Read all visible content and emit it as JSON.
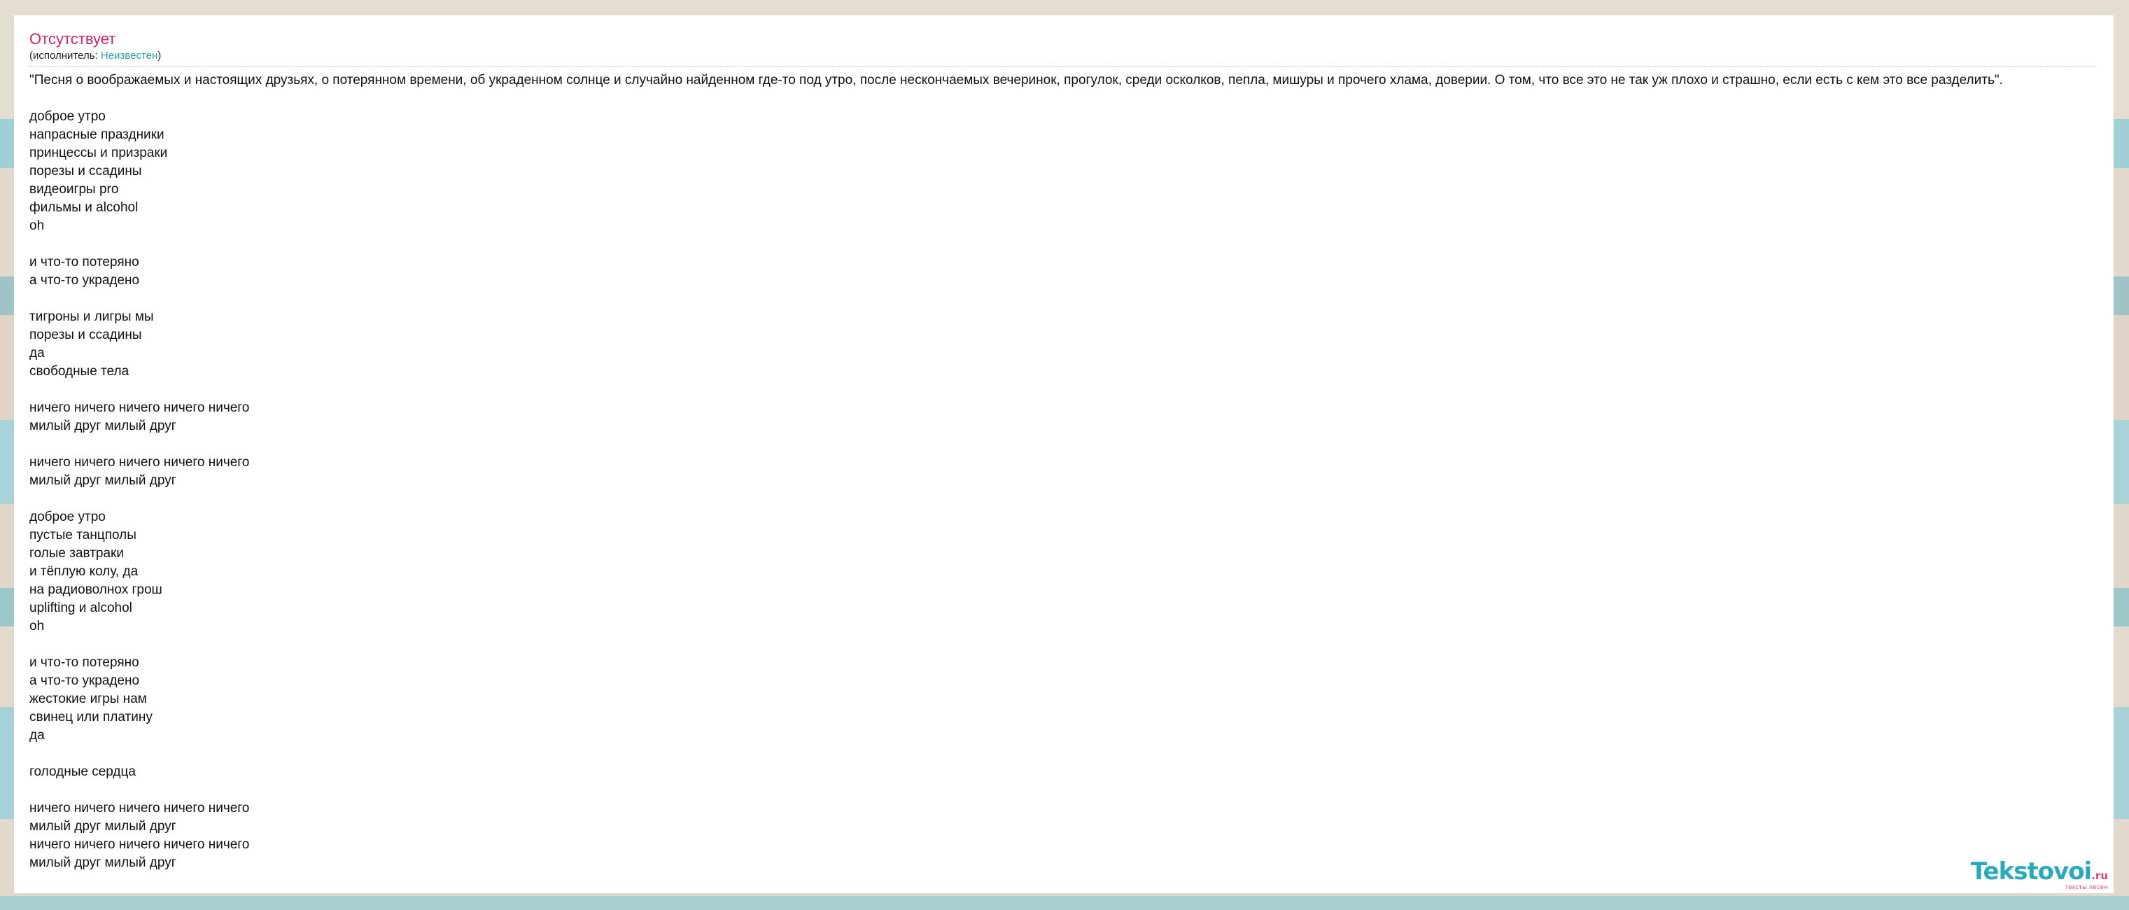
{
  "song": {
    "title": "Отсутствует",
    "artist_prefix": "(исполнитель: ",
    "artist_name": "Неизвестен",
    "artist_suffix": ")"
  },
  "description": "\"Песня о воображаемых и настоящих друзьях, о потерянном времени, об украденном солнце и случайно найденном где-то под утро, после нескончаемых вечеринок, прогулок, среди осколков, пепла, мишуры и прочего хлама, доверии. О том, что все это не так уж плохо и страшно, если есть с кем это все разделить\".",
  "lyrics": [
    "доброе утро",
    "напрасные праздники",
    "принцессы и призраки",
    "порезы и ссадины",
    "видеоигры pro",
    "фильмы и alcohol",
    "oh",
    "",
    "и что-то потеряно",
    "а что-то украдено",
    "",
    "тигроны и лигры мы",
    "порезы и ссадины",
    "да",
    "свободные тела",
    "",
    "ничего ничего ничего ничего ничего",
    "милый друг милый друг",
    "",
    "ничего ничего ничего ничего ничего",
    "милый друг милый друг",
    "",
    "доброе утро",
    "пустые танцполы",
    "голые завтраки",
    "и тёплую колу, да",
    "на радиоволнох грош",
    "uplifting и alcohol",
    "oh",
    "",
    "и что-то потеряно",
    "а что-то украдено",
    "жестокие игры нам",
    "свинец или платину",
    "да",
    "",
    "голодные сердца",
    "",
    "ничего ничего ничего ничего ничего",
    "милый друг милый друг",
    "ничего ничего ничего ничего ничего",
    "милый друг милый друг"
  ],
  "logo": {
    "name": "Tekstovoi",
    "domain": ".ru",
    "tagline": "тексты песен"
  },
  "colors": {
    "title": "#c8256a",
    "artist_link": "#2a9fb0",
    "logo_main": "#29a9b9",
    "logo_accent": "#e0407a"
  }
}
